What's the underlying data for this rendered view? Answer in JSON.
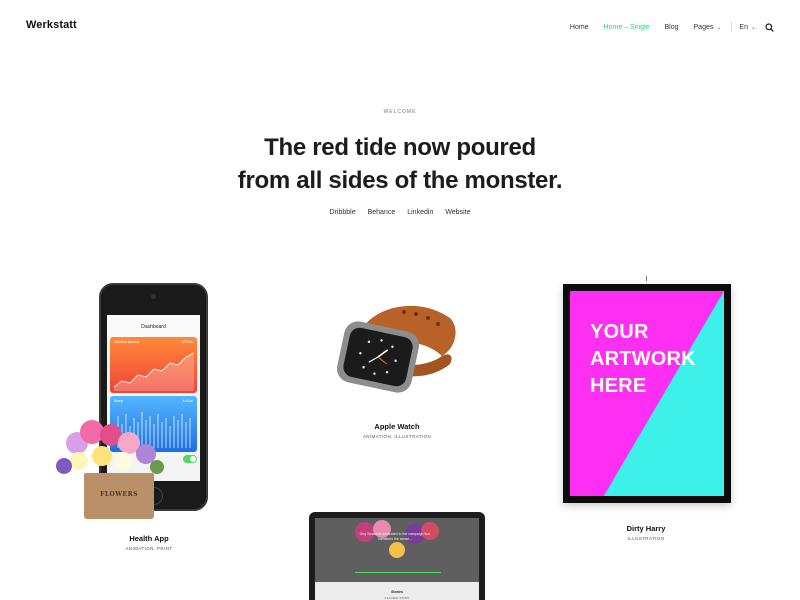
{
  "header": {
    "logo": "Werkstatt",
    "nav": [
      {
        "label": "Home",
        "active": false
      },
      {
        "label": "Home – Single",
        "active": true
      },
      {
        "label": "Blog",
        "active": false
      },
      {
        "label": "Pages",
        "active": false
      }
    ],
    "language": "En",
    "accent_color": "#2ed47a"
  },
  "hero": {
    "eyebrow": "WELCOME",
    "title_line1": "The red tide now poured",
    "title_line2": "from all sides of the monster.",
    "social": [
      "Dribbble",
      "Behance",
      "Linkedin",
      "Website"
    ]
  },
  "works": [
    {
      "title": "Health App",
      "categories": "ANIMATION, PRINT",
      "screen_title": "Dashboard",
      "card1_label": "Calories Burned",
      "card1_value": "470Cal",
      "card2_label": "Sleep",
      "card2_value": "6.9Cal",
      "bag_label": "FLOWERS"
    },
    {
      "title": "Apple Watch",
      "categories": "ANIMATION, ILLUSTRATION"
    },
    {
      "title": "Dirty Harry",
      "categories": "ILLUSTRATION",
      "poster_text": [
        "YOUR",
        "ARTWORK",
        "HERE"
      ]
    },
    {
      "screen_text": "Guy Swanson dedicated to the campaign that combines the sense...",
      "screen_caption": "Stories",
      "screen_sub": "A FLORAL STORY"
    }
  ]
}
